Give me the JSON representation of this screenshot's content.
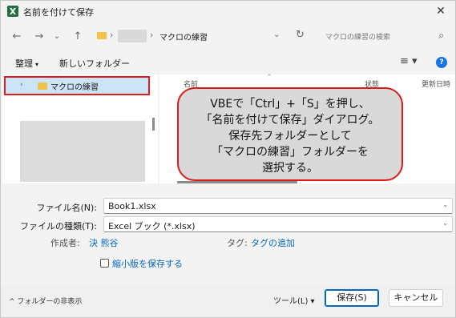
{
  "window": {
    "title": "名前を付けて保存",
    "close_glyph": "✕"
  },
  "address": {
    "back_glyph": "←",
    "forward_glyph": "→",
    "recent_glyph": "⌄",
    "up_glyph": "↑",
    "separator": "›",
    "current_folder": "マクロの練習",
    "dropdown_glyph": "⌄",
    "refresh_glyph": "↻"
  },
  "search": {
    "placeholder": "マクロの練習の検索",
    "icon_glyph": "⌕"
  },
  "toolbar": {
    "organize_label": "整理",
    "organize_arrow": "▾",
    "new_folder_label": "新しいフォルダー",
    "view_glyph": "≡ ▾",
    "help_glyph": "?"
  },
  "nav_pane": {
    "selected_item": "マクロの練習",
    "chevron": "›"
  },
  "columns": {
    "sort_glyph": "^",
    "name": "名前",
    "status": "状態",
    "date": "更新日時"
  },
  "callout": {
    "lines": [
      "VBEで「Ctrl」+「S」を押し、",
      "「名前を付けて保存」ダイアログ。",
      "保存先フォルダーとして",
      "「マクロの練習」フォルダーを",
      "選択する。"
    ]
  },
  "fields": {
    "filename_label": "ファイル名(N):",
    "filename_value": "Book1.xlsx",
    "filetype_label": "ファイルの種類(T):",
    "filetype_value": "Excel ブック (*.xlsx)",
    "dropdown_glyph": "⌄",
    "author_label": "作成者:",
    "author_value": "決 熊谷",
    "tags_label": "タグ:",
    "tags_value": "タグの追加",
    "thumbnail_label": "縮小版を保存する"
  },
  "bottom": {
    "hide_folders_label": "^ フォルダーの非表示",
    "tools_label": "ツール(L) ▾",
    "save_label": "保存(S)",
    "cancel_label": "キャンセル"
  },
  "colors": {
    "accent": "#0067c0",
    "selection": "#cce4f7",
    "highlight_border": "#e21b1b",
    "callout_fill": "#d9d9d9",
    "callout_border": "#d81b1b"
  }
}
